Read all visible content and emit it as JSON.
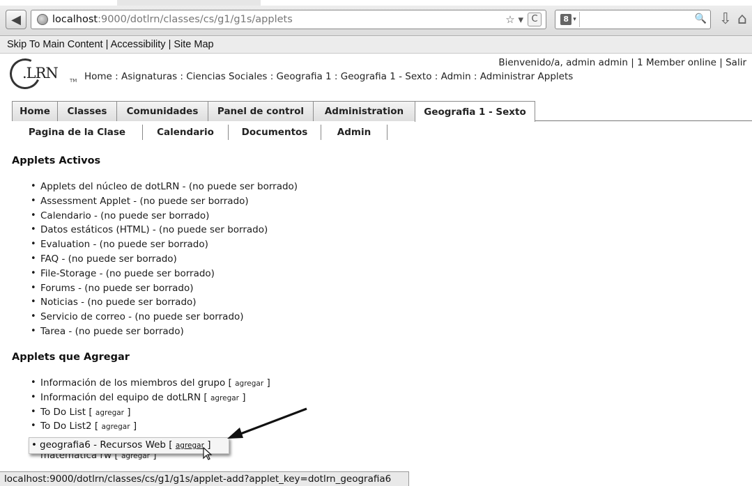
{
  "browser": {
    "url_host": "localhost",
    "url_path": ":9000/dotlrn/classes/cs/g1/g1s/applets",
    "search_placeholder": "",
    "url_right_glyphs": "☆ ▾",
    "reload_glyph": "C",
    "search_engine_glyph": "8",
    "search_dropdown_glyph": "▾",
    "search_glyph": "🔍",
    "back_glyph": "◀",
    "download_glyph": "⇩",
    "home_glyph": "⌂"
  },
  "skip_links": "Skip To Main Content | Accessibility | Site Map",
  "logo": {
    "text": ".LRN",
    "tm": "TM"
  },
  "header": {
    "welcome": "Bienvenido/a, admin admin | 1 Member online | Salir",
    "breadcrumb": "Home : Asignaturas : Ciencias Sociales : Geografia 1 : Geografia 1 - Sexto : Admin : Administrar Applets"
  },
  "tabs": [
    {
      "label": "Home"
    },
    {
      "label": "Classes"
    },
    {
      "label": "Comunidades"
    },
    {
      "label": "Panel de control"
    },
    {
      "label": "Administration"
    },
    {
      "label": "Geografia 1 - Sexto"
    }
  ],
  "subnav": [
    {
      "label": "Pagina de la Clase"
    },
    {
      "label": "Calendario"
    },
    {
      "label": "Documentos"
    },
    {
      "label": "Admin"
    }
  ],
  "active": {
    "heading": "Applets Activos",
    "items": [
      "Applets del núcleo de dotLRN - (no puede ser borrado)",
      "Assessment Applet - (no puede ser borrado)",
      "Calendario - (no puede ser borrado)",
      "Datos estáticos (HTML) - (no puede ser borrado)",
      "Evaluation - (no puede ser borrado)",
      "FAQ - (no puede ser borrado)",
      "File-Storage - (no puede ser borrado)",
      "Forums - (no puede ser borrado)",
      "Noticias - (no puede ser borrado)",
      "Servicio de correo - (no puede ser borrado)",
      "Tarea - (no puede ser borrado)"
    ]
  },
  "add": {
    "heading": "Applets que Agregar",
    "link_label": "agregar",
    "items": [
      "Información de los miembros del grupo",
      "Información del equipo de dotLRN",
      "To Do List",
      "To Do List2"
    ],
    "highlighted": "geografia6 - Recursos Web",
    "cut_item": "matematica rw"
  },
  "status_url": "localhost:9000/dotlrn/classes/cs/g1/g1s/applet-add?applet_key=dotlrn_geografia6"
}
